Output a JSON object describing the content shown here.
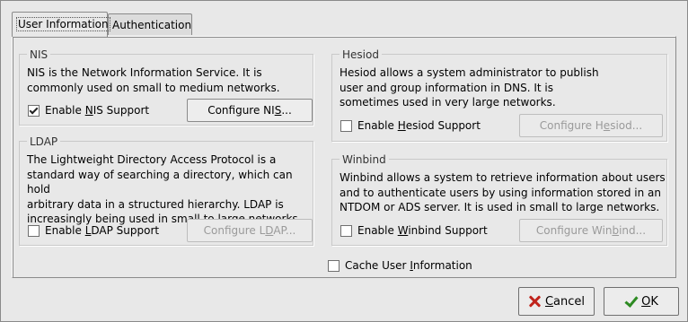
{
  "tabs": [
    {
      "label": "User Information",
      "active": true
    },
    {
      "label": "Authentication",
      "active": false
    }
  ],
  "nis": {
    "title": "NIS",
    "description": [
      "NIS is the Network Information Service.  It is",
      "commonly used on small to medium networks."
    ],
    "checkbox_label": {
      "pre": "Enable ",
      "key": "N",
      "post": "IS Support"
    },
    "checked": true,
    "button": {
      "pre": "Configure NI",
      "key": "S",
      "post": "..."
    }
  },
  "ldap": {
    "title": "LDAP",
    "description": [
      "The Lightweight Directory Access Protocol is a",
      "standard way of searching a directory, which can hold",
      "arbitrary data in a structured hierarchy.  LDAP is",
      "increasingly being used in small to large networks."
    ],
    "checkbox_label": {
      "pre": "Enable ",
      "key": "L",
      "post": "DAP Support"
    },
    "checked": false,
    "button": {
      "pre": "Configure L",
      "key": "D",
      "post": "AP..."
    }
  },
  "hesiod": {
    "title": "Hesiod",
    "description": [
      "Hesiod allows a system administrator to publish",
      "user and group information in DNS.  It is",
      "sometimes used in very large networks."
    ],
    "checkbox_label": {
      "pre": "Enable ",
      "key": "H",
      "post": "esiod Support"
    },
    "checked": false,
    "button": {
      "pre": "Configure H",
      "key": "e",
      "post": "siod..."
    }
  },
  "winbind": {
    "title": "Winbind",
    "description": [
      "Winbind allows a system to retrieve information about users",
      "and to authenticate users by using information stored in an",
      "NTDOM or ADS server.  It is used in small to large networks."
    ],
    "checkbox_label": {
      "pre": "Enable ",
      "key": "W",
      "post": "inbind Support"
    },
    "checked": false,
    "button": {
      "pre": "Configure Win",
      "key": "b",
      "post": "ind..."
    }
  },
  "cache": {
    "label": {
      "pre": "Cache User ",
      "key": "I",
      "post": "nformation"
    },
    "checked": false
  },
  "buttons": {
    "cancel": {
      "pre": "",
      "key": "C",
      "post": "ancel",
      "icon": "cancel-x-icon"
    },
    "ok": {
      "pre": "",
      "key": "O",
      "post": "K",
      "icon": "checkmark-icon"
    }
  }
}
